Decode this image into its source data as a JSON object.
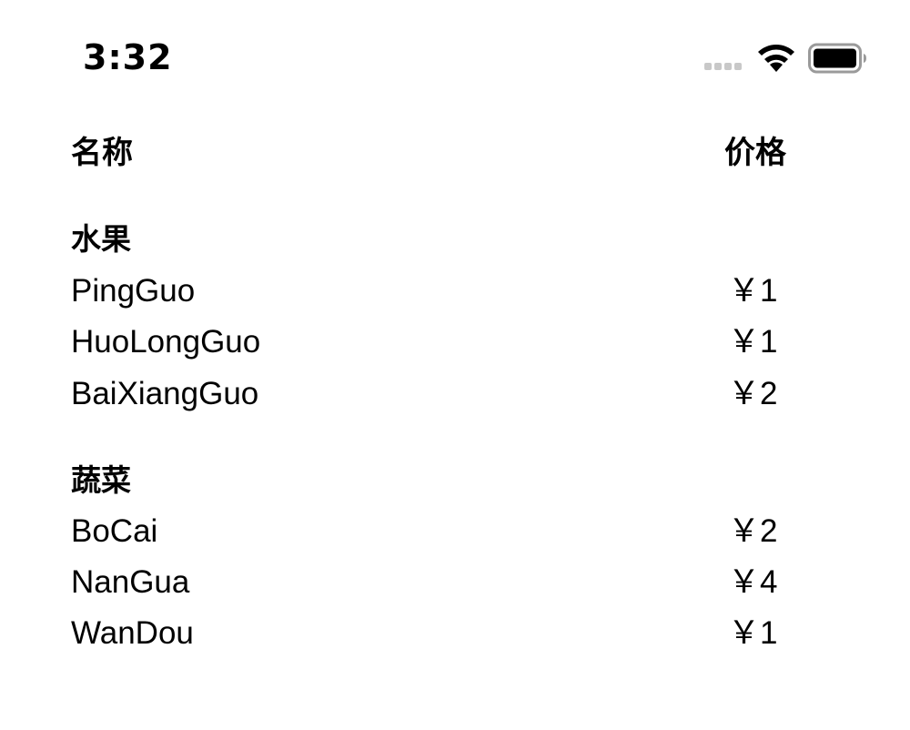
{
  "status_bar": {
    "time": "3:32",
    "icons": [
      "signal-icon",
      "wifi-icon",
      "battery-icon"
    ]
  },
  "table": {
    "headers": {
      "name": "名称",
      "price": "价格"
    },
    "sections": [
      {
        "title": "水果",
        "items": [
          {
            "name": "PingGuo",
            "price": "￥1"
          },
          {
            "name": "HuoLongGuo",
            "price": "￥1"
          },
          {
            "name": "BaiXiangGuo",
            "price": "￥2"
          }
        ]
      },
      {
        "title": "蔬菜",
        "items": [
          {
            "name": "BoCai",
            "price": "￥2"
          },
          {
            "name": "NanGua",
            "price": "￥4"
          },
          {
            "name": "WanDou",
            "price": "￥1"
          }
        ]
      }
    ]
  }
}
